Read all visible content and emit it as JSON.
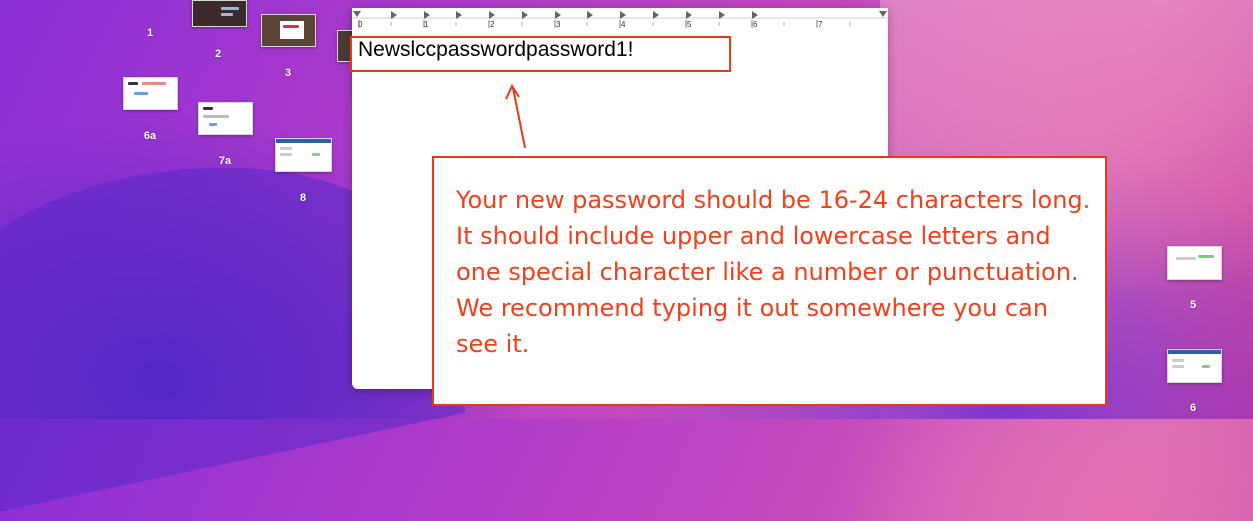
{
  "desktop": {
    "icons": [
      {
        "label": "1",
        "kind": "blank"
      },
      {
        "label": "2",
        "kind": "dark-banner"
      },
      {
        "label": "3",
        "kind": "photo-dialog"
      },
      {
        "label": "6a",
        "kind": "form"
      },
      {
        "label": "7a",
        "kind": "form"
      },
      {
        "label": "8",
        "kind": "table"
      },
      {
        "label": "5",
        "kind": "form-green"
      },
      {
        "label": "6",
        "kind": "table"
      }
    ]
  },
  "document": {
    "ruler_numbers": [
      "0",
      "1",
      "2",
      "3",
      "4",
      "5",
      "6",
      "7"
    ],
    "text": "Newslccpasswordpassword1!"
  },
  "callout": {
    "text": "Your new password should be 16-24 characters long. It should include upper and lowercase letters and one special character like a number or punctuation. We recommend typing it out somewhere you can see it."
  },
  "colors": {
    "annotation": "#e53a1a",
    "callout_text": "#f0401c"
  }
}
